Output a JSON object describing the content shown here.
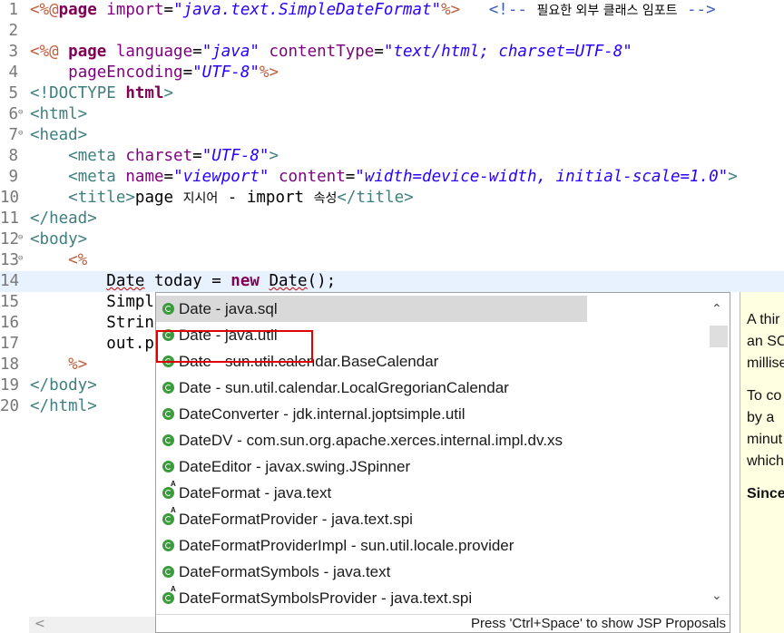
{
  "editor": {
    "lines": [
      {
        "no": "1",
        "fold": "",
        "parts": [
          [
            "jsp",
            "<%@"
          ],
          [
            "kw",
            "page "
          ],
          [
            "attr",
            "import"
          ],
          [
            "txt",
            "="
          ],
          [
            "str",
            "\"java.text.SimpleDateFormat\""
          ],
          [
            "jsp",
            "%>"
          ],
          [
            "txt",
            "   "
          ],
          [
            "cmt",
            "<!-- "
          ],
          [
            "kr",
            "필요한 외부 클래스 임포트"
          ],
          [
            "cmt",
            " -->"
          ]
        ]
      },
      {
        "no": "2",
        "fold": "",
        "parts": []
      },
      {
        "no": "3",
        "fold": "",
        "parts": [
          [
            "jsp",
            "<%@"
          ],
          [
            "txt",
            " "
          ],
          [
            "kw",
            "page "
          ],
          [
            "attr",
            "language"
          ],
          [
            "txt",
            "="
          ],
          [
            "str",
            "\"java\""
          ],
          [
            "txt",
            " "
          ],
          [
            "attr",
            "contentType"
          ],
          [
            "txt",
            "="
          ],
          [
            "str",
            "\"text/html; charset=UTF-8\""
          ]
        ]
      },
      {
        "no": "4",
        "fold": "",
        "parts": [
          [
            "txt",
            "    "
          ],
          [
            "attr",
            "pageEncoding"
          ],
          [
            "txt",
            "="
          ],
          [
            "str",
            "\"UTF-8\""
          ],
          [
            "jsp",
            "%>"
          ]
        ]
      },
      {
        "no": "5",
        "fold": "",
        "parts": [
          [
            "tag",
            "<!DOCTYPE "
          ],
          [
            "kw",
            "html"
          ],
          [
            "tag",
            ">"
          ]
        ]
      },
      {
        "no": "6",
        "fold": "⊖",
        "parts": [
          [
            "tag",
            "<html>"
          ]
        ]
      },
      {
        "no": "7",
        "fold": "⊖",
        "parts": [
          [
            "tag",
            "<head>"
          ]
        ]
      },
      {
        "no": "8",
        "fold": "",
        "parts": [
          [
            "txt",
            "    "
          ],
          [
            "tag",
            "<meta "
          ],
          [
            "attr",
            "charset"
          ],
          [
            "txt",
            "="
          ],
          [
            "str",
            "\"UTF-8\""
          ],
          [
            "tag",
            ">"
          ]
        ]
      },
      {
        "no": "9",
        "fold": "",
        "parts": [
          [
            "txt",
            "    "
          ],
          [
            "tag",
            "<meta "
          ],
          [
            "attr",
            "name"
          ],
          [
            "txt",
            "="
          ],
          [
            "str",
            "\"viewport\""
          ],
          [
            "txt",
            " "
          ],
          [
            "attr",
            "content"
          ],
          [
            "txt",
            "="
          ],
          [
            "str",
            "\"width=device-width, initial-scale=1.0\""
          ],
          [
            "tag",
            ">"
          ]
        ]
      },
      {
        "no": "10",
        "fold": "",
        "parts": [
          [
            "txt",
            "    "
          ],
          [
            "tag",
            "<title>"
          ],
          [
            "txt",
            "page "
          ],
          [
            "kr",
            "지시어"
          ],
          [
            "txt",
            " - import "
          ],
          [
            "kr",
            "속성"
          ],
          [
            "tag",
            "</title>"
          ]
        ]
      },
      {
        "no": "11",
        "fold": "",
        "parts": [
          [
            "tag",
            "</head>"
          ]
        ]
      },
      {
        "no": "12",
        "fold": "⊖",
        "parts": [
          [
            "tag",
            "<body>"
          ]
        ]
      },
      {
        "no": "13",
        "fold": "⊖",
        "parts": [
          [
            "txt",
            "    "
          ],
          [
            "jsp",
            "<%"
          ]
        ]
      },
      {
        "no": "14",
        "fold": "",
        "parts": [
          [
            "txt",
            "        "
          ],
          [
            "uline",
            "Date"
          ],
          [
            "txt",
            " today = "
          ],
          [
            "kw",
            "new "
          ],
          [
            "uline",
            "Date"
          ],
          [
            "txt",
            "();"
          ]
        ]
      },
      {
        "no": "15",
        "fold": "",
        "parts": [
          [
            "txt",
            "        Simpl"
          ]
        ]
      },
      {
        "no": "16",
        "fold": "",
        "parts": [
          [
            "txt",
            "        Strin"
          ]
        ]
      },
      {
        "no": "17",
        "fold": "",
        "parts": [
          [
            "txt",
            "        out.p"
          ]
        ]
      },
      {
        "no": "18",
        "fold": "",
        "parts": [
          [
            "txt",
            "    "
          ],
          [
            "jsp",
            "%>"
          ]
        ]
      },
      {
        "no": "19",
        "fold": "",
        "parts": [
          [
            "tag",
            "</body>"
          ]
        ]
      },
      {
        "no": "20",
        "fold": "",
        "parts": [
          [
            "tag",
            "</html>"
          ]
        ]
      }
    ]
  },
  "assist": {
    "proposals": [
      {
        "label": "Date - java.sql",
        "abstract": false
      },
      {
        "label": "Date - java.util",
        "abstract": false
      },
      {
        "label": "Date - sun.util.calendar.BaseCalendar",
        "abstract": false
      },
      {
        "label": "Date - sun.util.calendar.LocalGregorianCalendar",
        "abstract": false
      },
      {
        "label": "DateConverter - jdk.internal.joptsimple.util",
        "abstract": false
      },
      {
        "label": "DateDV - com.sun.org.apache.xerces.internal.impl.dv.xs",
        "abstract": false
      },
      {
        "label": "DateEditor - javax.swing.JSpinner",
        "abstract": false
      },
      {
        "label": "DateFormat - java.text",
        "abstract": true
      },
      {
        "label": "DateFormatProvider - java.text.spi",
        "abstract": true
      },
      {
        "label": "DateFormatProviderImpl - sun.util.locale.provider",
        "abstract": false
      },
      {
        "label": "DateFormatSymbols - java.text",
        "abstract": false
      },
      {
        "label": "DateFormatSymbolsProvider - java.text.spi",
        "abstract": true
      }
    ],
    "selected_index": 0,
    "status": "Press 'Ctrl+Space' to show JSP Proposals"
  },
  "doc": {
    "lines": [
      "A thir",
      "an SC",
      "millise",
      "",
      "To co",
      "by a",
      "minut",
      "which",
      "",
      "Since"
    ]
  },
  "colors": {
    "highlight": "#e00000",
    "current_line": "#e8f2fe",
    "selection": "#d9d9d9",
    "javadoc_bg": "#ffffe1"
  }
}
